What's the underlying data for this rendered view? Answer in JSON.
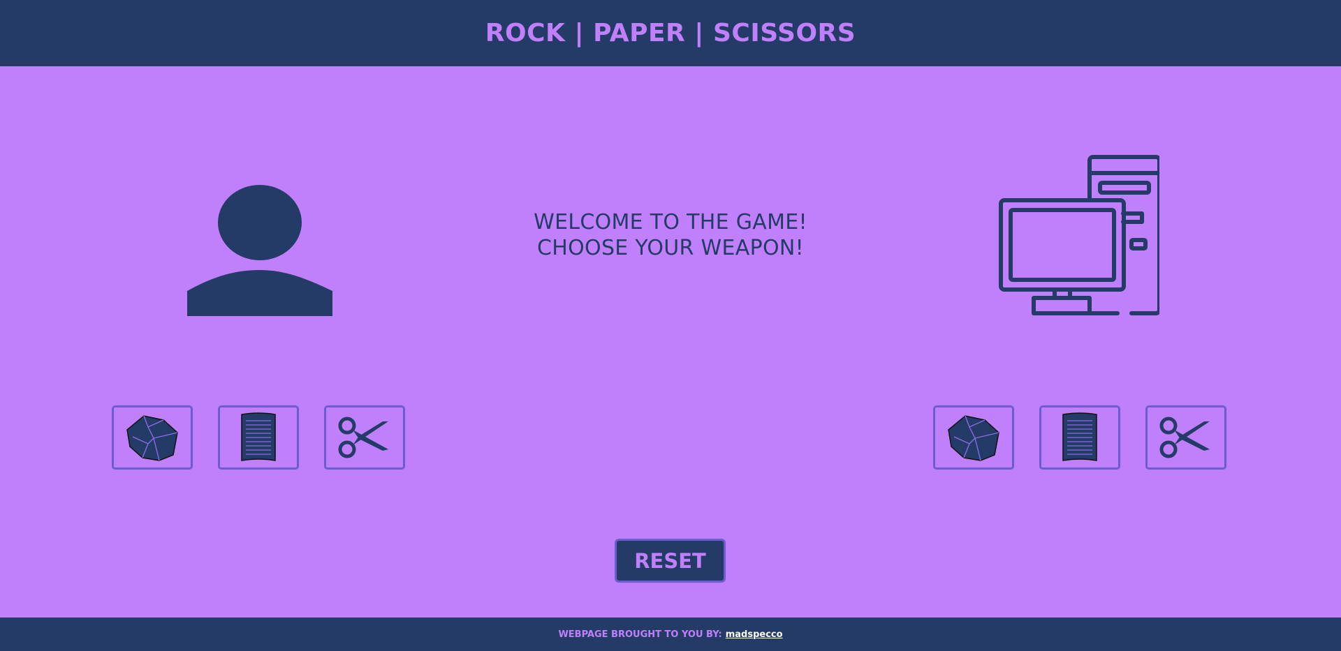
{
  "header": {
    "title": "ROCK | PAPER | SCISSORS"
  },
  "player": {
    "avatar_icon": "person-silhouette-icon"
  },
  "computer": {
    "avatar_icon": "desktop-computer-icon"
  },
  "message": {
    "line1": "WELCOME TO THE GAME!",
    "line2": "CHOOSE YOUR WEAPON!"
  },
  "weapons": [
    {
      "id": "rock",
      "icon": "rock-icon"
    },
    {
      "id": "paper",
      "icon": "paper-icon"
    },
    {
      "id": "scissors",
      "icon": "scissors-icon"
    }
  ],
  "reset": {
    "label": "RESET"
  },
  "footer": {
    "label": "WEBPAGE BROUGHT TO YOU BY:",
    "author": "madspecco"
  },
  "colors": {
    "background": "#c080fb",
    "navy": "#233b66",
    "accent_border": "#6b5ccf"
  }
}
